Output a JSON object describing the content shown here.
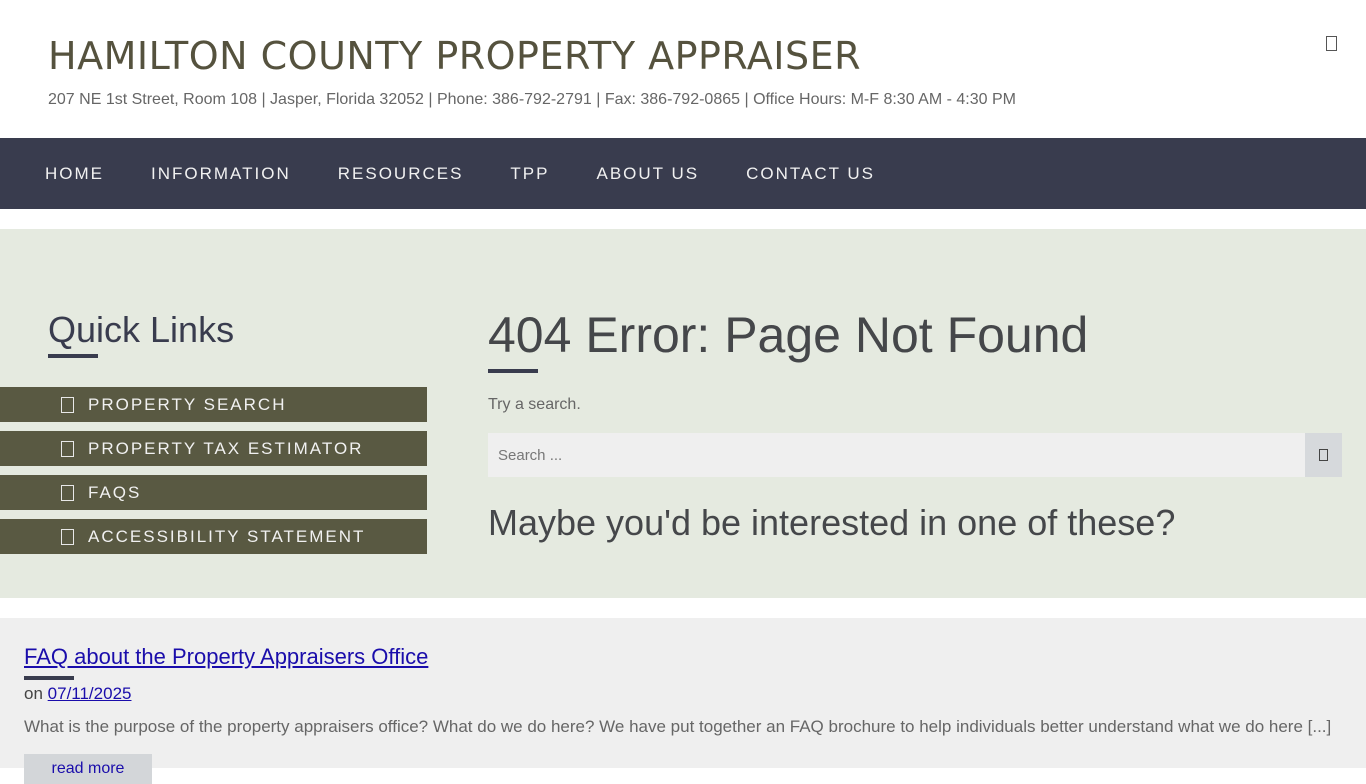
{
  "header": {
    "title": "HAMILTON COUNTY PROPERTY APPRAISER",
    "info": "207 NE 1st Street, Room 108 | Jasper, Florida 32052 | Phone: 386-792-2791 | Fax: 386-792-0865 | Office Hours: M-F 8:30 AM - 4:30 PM"
  },
  "nav": {
    "items": [
      "HOME",
      "INFORMATION",
      "RESOURCES",
      "TPP",
      "ABOUT US",
      "CONTACT US"
    ]
  },
  "quick_links": {
    "title": "Quick Links",
    "items": [
      "PROPERTY SEARCH",
      "PROPERTY TAX ESTIMATOR",
      "FAQS",
      "ACCESSIBILITY STATEMENT"
    ]
  },
  "content": {
    "error_title": "404 Error: Page Not Found",
    "try_text": "Try a search.",
    "search_placeholder": "Search ...",
    "maybe_title": "Maybe you'd be interested in one of these?"
  },
  "post": {
    "title": "FAQ about the Property Appraisers Office",
    "date_prefix": "on",
    "date": "07/11/2025",
    "excerpt": "What is the purpose of the property appraisers office? What do we do here? We have put together an FAQ brochure to help individuals better understand what we do here [...]",
    "read_more": "read more"
  },
  "colors": {
    "nav_bg": "#393c4e",
    "quick_link_bg": "#595942",
    "main_bg": "#e5eae0",
    "title_color": "#55523e"
  }
}
